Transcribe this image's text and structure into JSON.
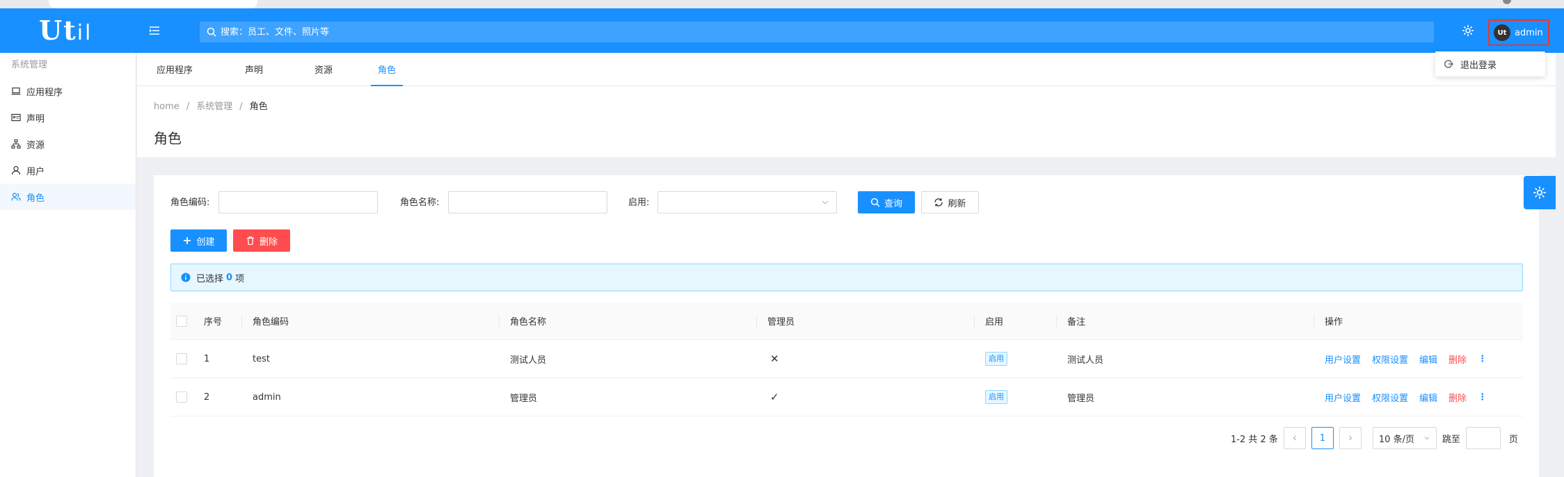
{
  "header": {
    "logo": "Ut",
    "logo_suffix": "il",
    "search_placeholder": "搜索：员工、文件、照片等",
    "username": "admin",
    "avatar_text": "Ut"
  },
  "dropdown": {
    "logout": "退出登录"
  },
  "sidebar": {
    "group": "系统管理",
    "items": [
      {
        "label": "应用程序",
        "icon": "laptop-icon"
      },
      {
        "label": "声明",
        "icon": "id-card-icon"
      },
      {
        "label": "资源",
        "icon": "tree-icon"
      },
      {
        "label": "用户",
        "icon": "user-icon"
      },
      {
        "label": "角色",
        "icon": "team-icon",
        "active": true
      }
    ]
  },
  "tabs": [
    "应用程序",
    "声明",
    "资源",
    "角色"
  ],
  "breadcrumb": [
    "home",
    "系统管理",
    "角色"
  ],
  "page_title": "角色",
  "filters": {
    "code_label": "角色编码:",
    "name_label": "角色名称:",
    "enabled_label": "启用:",
    "query_button": "查询",
    "refresh_button": "刷新"
  },
  "actions": {
    "create": "创建",
    "delete": "删除"
  },
  "alert": {
    "prefix": "已选择",
    "count": "0",
    "suffix": "项"
  },
  "table": {
    "headers": [
      "序号",
      "角色编码",
      "角色名称",
      "管理员",
      "启用",
      "备注",
      "操作"
    ],
    "rows": [
      {
        "index": "1",
        "code": "test",
        "name": "测试人员",
        "admin": "✕",
        "enabled": "启用",
        "remark": "测试人员"
      },
      {
        "index": "2",
        "code": "admin",
        "name": "管理员",
        "admin": "✓",
        "enabled": "启用",
        "remark": "管理员"
      }
    ],
    "row_actions": [
      "用户设置",
      "权限设置",
      "编辑",
      "删除"
    ],
    "more": "⋮"
  },
  "pagination": {
    "total": "1-2 共 2 条",
    "current": "1",
    "page_size": "10 条/页",
    "jump_label": "跳至",
    "page_suffix": "页"
  },
  "colors": {
    "primary": "#1890ff",
    "danger": "#ff4d4f"
  }
}
